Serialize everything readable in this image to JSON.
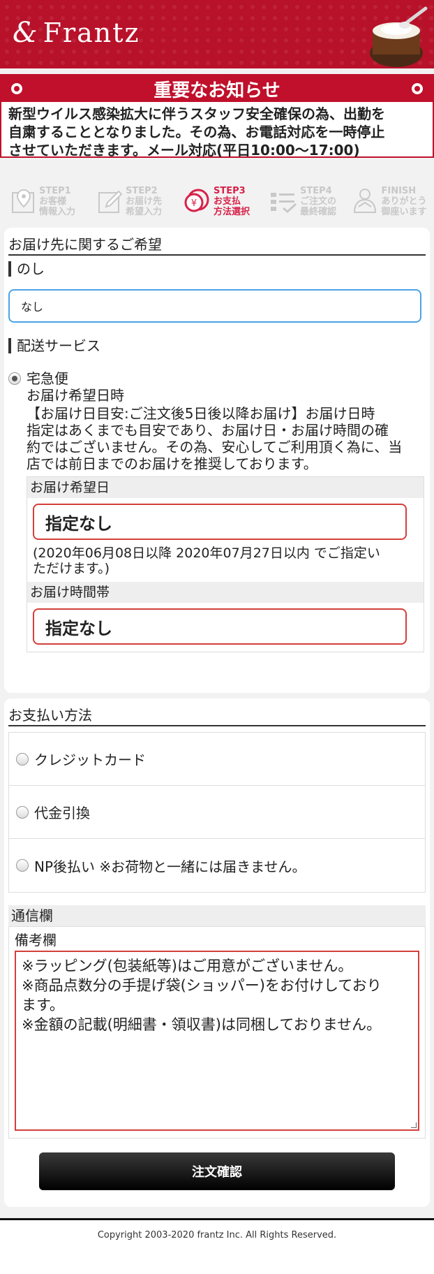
{
  "header": {
    "logo_text": "Frantz",
    "logo_mark": "&",
    "brand_color": "#b8112a"
  },
  "notice": {
    "title": "重要なお知らせ",
    "lines": [
      "新型ウイルス感染拡大に伴うスタッフ安全確保の為、出勤を",
      "自粛することとなりました。その為、お電話対応を一時停止",
      "させていただきます。メール対応(平日10:00〜17:00)"
    ]
  },
  "steps": [
    {
      "label1": "STEP1",
      "label2": "お客様",
      "label3": "情報入力",
      "icon": "location-pin-icon",
      "active": false
    },
    {
      "label1": "STEP2",
      "label2": "お届け先",
      "label3": "希望入力",
      "icon": "pencil-edit-icon",
      "active": false
    },
    {
      "label1": "STEP3",
      "label2": "お支払",
      "label3": "方法選択",
      "icon": "coin-payment-icon",
      "active": true
    },
    {
      "label1": "STEP4",
      "label2": "ご注文の",
      "label3": "最終確認",
      "icon": "checklist-icon",
      "active": false
    },
    {
      "label1": "FINISH",
      "label2": "ありがとう",
      "label3": "御座います",
      "icon": "thanks-icon",
      "active": false
    }
  ],
  "delivery_section": {
    "title": "お届け先に関するご希望",
    "noshi_label": "のし",
    "noshi_value": "なし",
    "service_label": "配送サービス",
    "service_option": "宅急便",
    "wish_datetime": "お届け希望日時",
    "guide_lines": [
      "【お届け日目安:ご注文後5日後以降お届け】お届け日時",
      "指定はあくまでも目安であり、お届け日・お届け時間の確",
      "約ではございません。その為、安心してご利用頂く為に、当",
      "店では前日までのお届けを推奨しております。"
    ],
    "date_label": "お届け希望日",
    "date_value": "指定なし",
    "date_note_line1": "(2020年06月08日以降 2020年07月27日以内 でご指定い",
    "date_note_line2": "ただけます。)",
    "time_label": "お届け時間帯",
    "time_value": "指定なし"
  },
  "payment_section": {
    "title": "お支払い方法",
    "options": [
      "クレジットカード",
      "代金引換",
      "NP後払い ※お荷物と一緒には届きません。"
    ],
    "comm_title": "通信欄",
    "biko_label": "備考欄",
    "biko_lines": [
      "※ラッピング(包装紙等)はご用意がございません。",
      "※商品点数分の手提げ袋(ショッパー)をお付けしており",
      "ます。",
      "※金額の記載(明細書・領収書)は同梱しておりません。"
    ],
    "confirm_button": "注文確認"
  },
  "footer": {
    "copyright": "Copyright 2003-2020 frantz Inc. All Rights Reserved."
  }
}
